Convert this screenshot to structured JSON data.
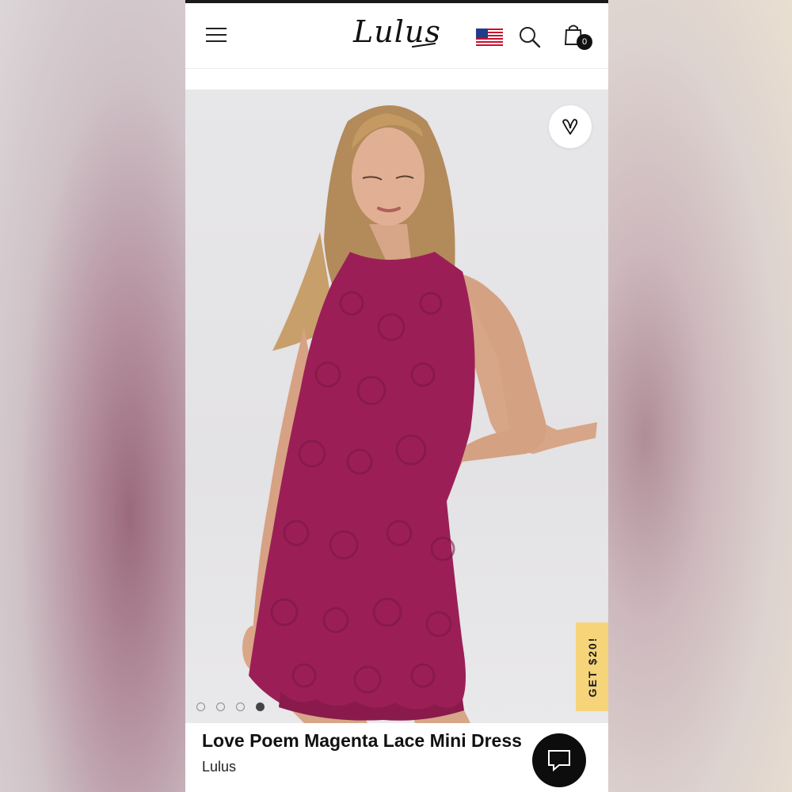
{
  "header": {
    "logo_text": "Lulus",
    "menu_icon": "hamburger-menu-icon",
    "flag_icon": "us-flag-icon",
    "search_icon": "search-icon",
    "bag_icon": "shopping-bag-icon",
    "bag_count": "0"
  },
  "gallery": {
    "favorite_icon": "heart-icon",
    "dots_count": 4,
    "active_dot": 4
  },
  "promo": {
    "label": "GET $20!",
    "color": "#f6d57a"
  },
  "product": {
    "title": "Love Poem Magenta Lace Mini Dress",
    "brand": "Lulus",
    "dress_color": "#9b1f56"
  },
  "chat": {
    "icon": "chat-bubble-icon"
  }
}
